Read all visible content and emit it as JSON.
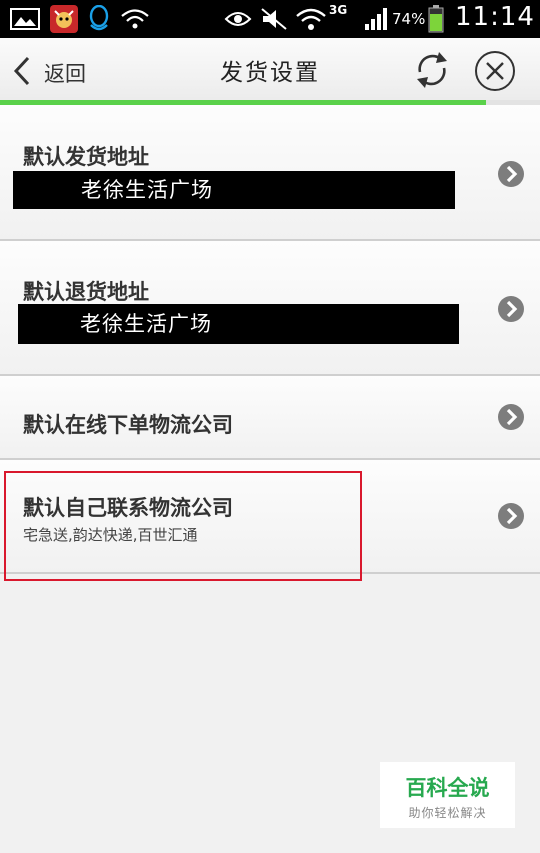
{
  "status_bar": {
    "network": "3G",
    "battery": "74%",
    "time": "11:14"
  },
  "header": {
    "back_label": "返回",
    "title": "发货设置"
  },
  "page_load_progress": 0.9,
  "rows": [
    {
      "title": "默认发货地址",
      "value": "老徐生活广场"
    },
    {
      "title": "默认退货地址",
      "value": "老徐生活广场"
    },
    {
      "title": "默认在线下单物流公司"
    },
    {
      "title": "默认自己联系物流公司",
      "subtitle": "宅急送,韵达快递,百世汇通"
    }
  ],
  "watermark": {
    "title": "百科全说",
    "subtitle": "助你轻松解决"
  },
  "colors": {
    "progress": "#5ad14a",
    "highlight_border": "#d9182d",
    "watermark_green": "#27a94f"
  }
}
